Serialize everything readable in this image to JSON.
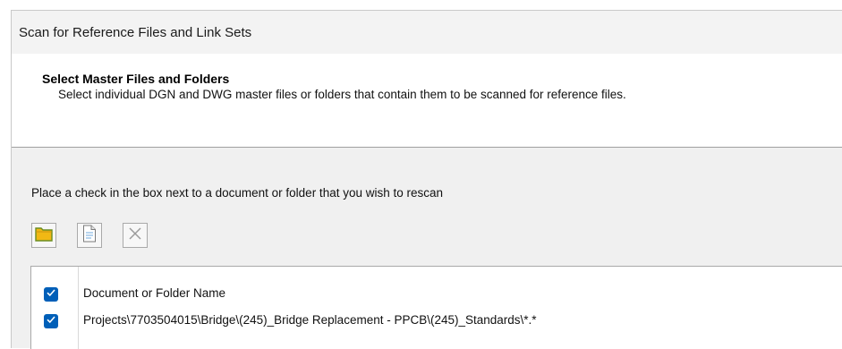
{
  "window": {
    "title": "Scan for Reference Files and Link Sets"
  },
  "header": {
    "title": "Select Master Files and Folders",
    "subtitle": "Select individual DGN and DWG master files or folders that contain them to be scanned for reference files."
  },
  "instruction": "Place a check in the box next to a document or folder that you wish to rescan",
  "toolbar": {
    "buttons": [
      {
        "icon": "folder-icon"
      },
      {
        "icon": "document-icon"
      },
      {
        "icon": "close-icon"
      }
    ]
  },
  "list": {
    "header_label": "Document or Folder Name",
    "header_checked": true,
    "items": [
      {
        "path": "Projects\\7703504015\\Bridge\\(245)_Bridge Replacement - PPCB\\(245)_Standards\\*.*",
        "checked": true
      }
    ]
  },
  "colors": {
    "accent": "#005fb8",
    "folder_fill": "#f1b814",
    "folder_border": "#6b8e23"
  }
}
